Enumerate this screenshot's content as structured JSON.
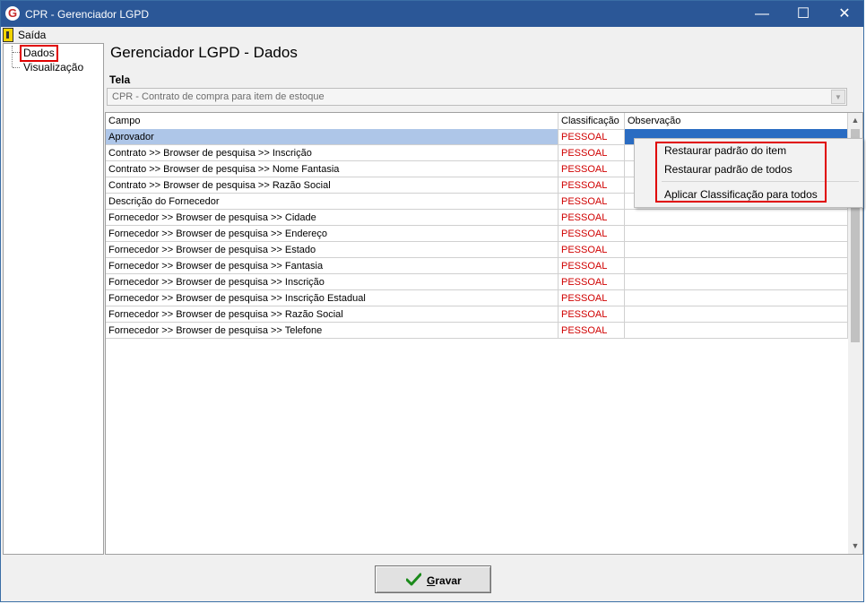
{
  "window": {
    "title": "CPR - Gerenciador LGPD",
    "app_icon": "G",
    "controls": {
      "minimize": "—",
      "maximize": "☐",
      "close": "✕"
    }
  },
  "menubar": {
    "items": [
      {
        "label": "Saída",
        "icon": "exit-door-icon"
      }
    ]
  },
  "tree": {
    "items": [
      {
        "label": "Dados"
      },
      {
        "label": "Visualização"
      }
    ]
  },
  "main": {
    "title": "Gerenciador LGPD - Dados",
    "screen_label": "Tela",
    "screen_combo_value": "CPR - Contrato de compra para item de estoque"
  },
  "grid": {
    "columns": [
      "Campo",
      "Classificação",
      "Observação"
    ],
    "rows": [
      {
        "campo": "Aprovador",
        "classificacao": "PESSOAL",
        "observacao": ""
      },
      {
        "campo": "Contrato >> Browser de pesquisa >> Inscrição",
        "classificacao": "PESSOAL",
        "observacao": ""
      },
      {
        "campo": "Contrato >> Browser de pesquisa >> Nome Fantasia",
        "classificacao": "PESSOAL",
        "observacao": ""
      },
      {
        "campo": "Contrato >> Browser de pesquisa >> Razão Social",
        "classificacao": "PESSOAL",
        "observacao": ""
      },
      {
        "campo": "Descrição do Fornecedor",
        "classificacao": "PESSOAL",
        "observacao": ""
      },
      {
        "campo": "Fornecedor >> Browser de pesquisa >> Cidade",
        "classificacao": "PESSOAL",
        "observacao": ""
      },
      {
        "campo": "Fornecedor >> Browser de pesquisa >> Endereço",
        "classificacao": "PESSOAL",
        "observacao": ""
      },
      {
        "campo": "Fornecedor >> Browser de pesquisa >> Estado",
        "classificacao": "PESSOAL",
        "observacao": ""
      },
      {
        "campo": "Fornecedor >> Browser de pesquisa >> Fantasia",
        "classificacao": "PESSOAL",
        "observacao": ""
      },
      {
        "campo": "Fornecedor >> Browser de pesquisa >> Inscrição",
        "classificacao": "PESSOAL",
        "observacao": ""
      },
      {
        "campo": "Fornecedor >> Browser de pesquisa >> Inscrição Estadual",
        "classificacao": "PESSOAL",
        "observacao": ""
      },
      {
        "campo": "Fornecedor >> Browser de pesquisa >> Razão Social",
        "classificacao": "PESSOAL",
        "observacao": ""
      },
      {
        "campo": "Fornecedor >> Browser de pesquisa >> Telefone",
        "classificacao": "PESSOAL",
        "observacao": ""
      }
    ]
  },
  "context_menu": {
    "items": [
      {
        "label": "Restaurar padrão do item"
      },
      {
        "label": "Restaurar padrão de todos"
      },
      {
        "label": "Aplicar Classificação para todos"
      }
    ]
  },
  "footer": {
    "save_label_first": "G",
    "save_label_rest": "ravar",
    "save_icon": "green-check-icon"
  },
  "colors": {
    "title_bar": "#2b5797",
    "classification_text": "#d00000",
    "highlight_box": "#e00000",
    "selected_row": "#aec6e8"
  }
}
